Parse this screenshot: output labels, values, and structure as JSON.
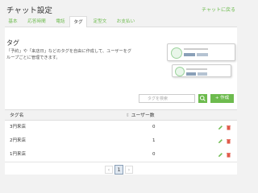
{
  "header": {
    "title": "チャット設定",
    "back_link": "チャットに戻る"
  },
  "tabs": [
    {
      "label": "基本"
    },
    {
      "label": "応答時間"
    },
    {
      "label": "電話"
    },
    {
      "label": "タグ"
    },
    {
      "label": "定型文"
    },
    {
      "label": "お支払い"
    }
  ],
  "section": {
    "title": "タグ",
    "description": "「予約」や「来店日」などのタグを自由に作成して、ユーザーをグループごとに管理できます。"
  },
  "search": {
    "placeholder": "タグを検索"
  },
  "create_button": "作成",
  "table": {
    "headers": [
      "タグ名",
      "ユーザー数"
    ],
    "rows": [
      {
        "name": "3円来店",
        "count": "0"
      },
      {
        "name": "2円来店",
        "count": "1"
      },
      {
        "name": "1円来店",
        "count": "0"
      }
    ]
  },
  "pagination": {
    "prev": "‹",
    "current": "1",
    "next": "›"
  },
  "colors": {
    "accent": "#6dbb4e",
    "delete": "#e05a4a",
    "background": "#f2f2f2"
  }
}
